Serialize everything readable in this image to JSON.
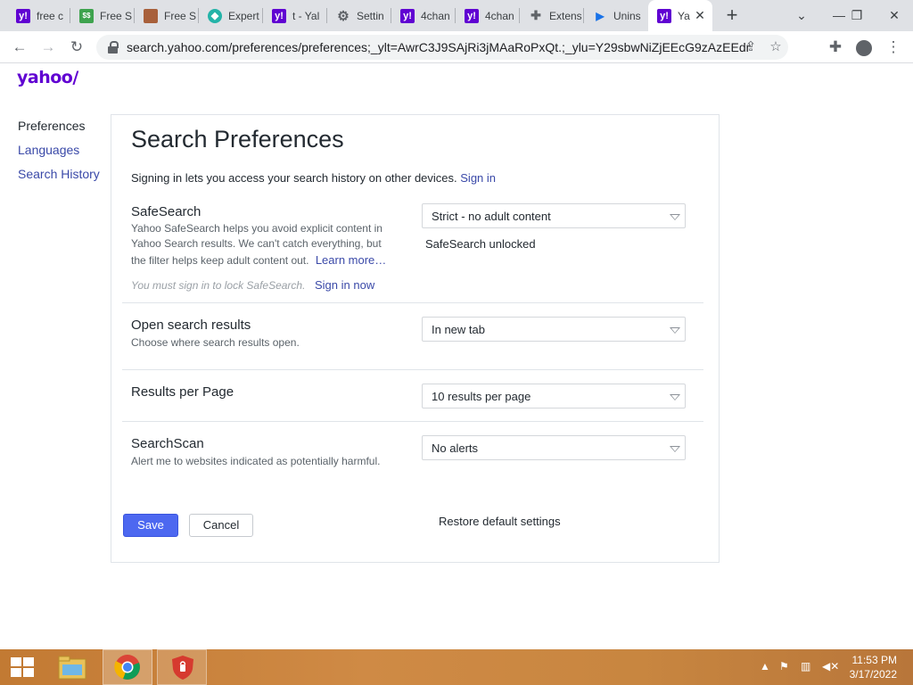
{
  "browser": {
    "tabs": [
      {
        "title": "free c",
        "favicon": "yahoo-icon"
      },
      {
        "title": "Free S",
        "favicon": "money-icon"
      },
      {
        "title": "Free S",
        "favicon": "photo-icon"
      },
      {
        "title": "Expert",
        "favicon": "diamond-icon"
      },
      {
        "title": "t - Yal",
        "favicon": "yahoo-icon"
      },
      {
        "title": "Settin",
        "favicon": "gear-icon"
      },
      {
        "title": "4chan",
        "favicon": "yahoo-icon"
      },
      {
        "title": "4chan",
        "favicon": "yahoo-icon"
      },
      {
        "title": "Extens",
        "favicon": "puzzle-icon"
      },
      {
        "title": "Unins",
        "favicon": "play-icon"
      },
      {
        "title": "Ya",
        "favicon": "yahoo-icon",
        "active": true
      }
    ],
    "url": "search.yahoo.com/preferences/preferences;_ylt=AwrC3J9SAjRi3jMAaRoPxQt.;_ylu=Y29sbwNiZjEEcG9zAzEEdnRpZ..."
  },
  "page": {
    "logo": "yahoo/",
    "nav": {
      "preferences": "Preferences",
      "languages": "Languages",
      "search_history": "Search History"
    },
    "title": "Search Preferences",
    "signin_text": "Signing in lets you access your search history on other devices.",
    "signin_link": "Sign in",
    "safesearch": {
      "title": "SafeSearch",
      "desc_1": "Yahoo SafeSearch helps you avoid explicit content in",
      "desc_2": "Yahoo Search results. We can't catch everything, but",
      "desc_3": "the filter helps keep adult content out.",
      "learn_more": "Learn more…",
      "note": "You must sign in to lock SafeSearch.",
      "signin_now": "Sign in now",
      "selected": "Strict - no adult content",
      "status": "SafeSearch unlocked"
    },
    "open_results": {
      "title": "Open search results",
      "desc": "Choose where search results open.",
      "selected": "In new tab"
    },
    "per_page": {
      "title": "Results per Page",
      "selected": "10 results per page"
    },
    "searchscan": {
      "title": "SearchScan",
      "desc": "Alert me to websites indicated as potentially harmful.",
      "selected": "No alerts"
    },
    "buttons": {
      "save": "Save",
      "cancel": "Cancel",
      "restore": "Restore default settings"
    }
  },
  "taskbar": {
    "time": "11:53 PM",
    "date": "3/17/2022"
  },
  "colors": {
    "yahoo_purple": "#6001d2",
    "link_blue": "#3a49a8",
    "save_blue": "#4d68f0"
  }
}
